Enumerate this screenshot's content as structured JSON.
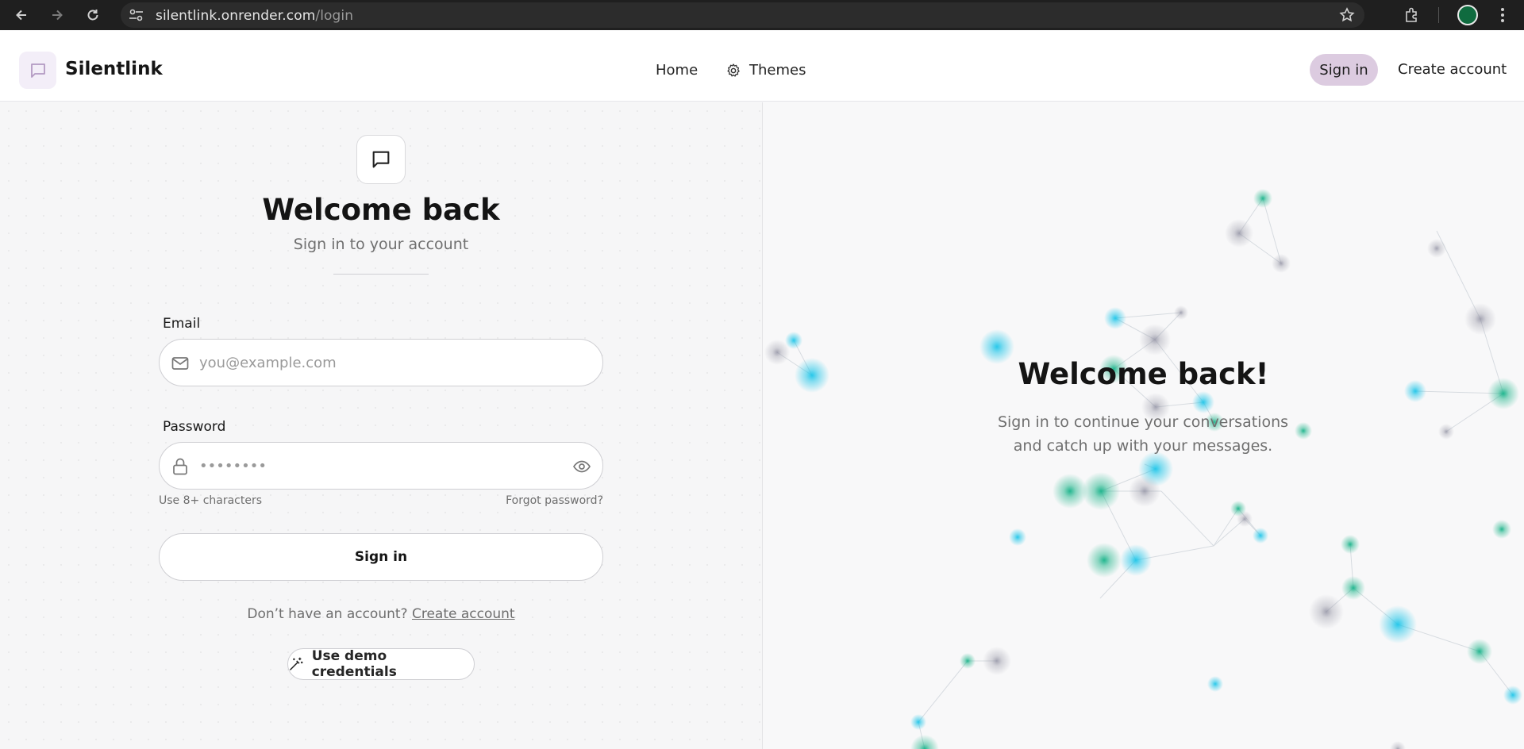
{
  "browser": {
    "url_host": "silentlink.onrender.com",
    "url_path": "/login"
  },
  "header": {
    "brand": "Silentlink",
    "nav": {
      "home": "Home",
      "themes": "Themes"
    },
    "sign_in": "Sign in",
    "create_account": "Create account"
  },
  "login": {
    "title": "Welcome back",
    "subtitle": "Sign in to your account",
    "email_label": "Email",
    "email_placeholder": "you@example.com",
    "password_label": "Password",
    "password_placeholder": "••••••••",
    "password_hint": "Use 8+ characters",
    "forgot_password": "Forgot password?",
    "submit": "Sign in",
    "no_account_text": "Don’t have an account?",
    "create_account_link": "Create account",
    "demo_button": "Use demo credentials"
  },
  "hero": {
    "title": "Welcome back!",
    "subtitle": "Sign in to continue your conversations and catch up with your messages."
  },
  "colors": {
    "accent_pill": "#dccbe0",
    "node_cyan": "#23c6e8",
    "node_teal": "#1fb48a",
    "node_gray": "#9a9aa8"
  }
}
